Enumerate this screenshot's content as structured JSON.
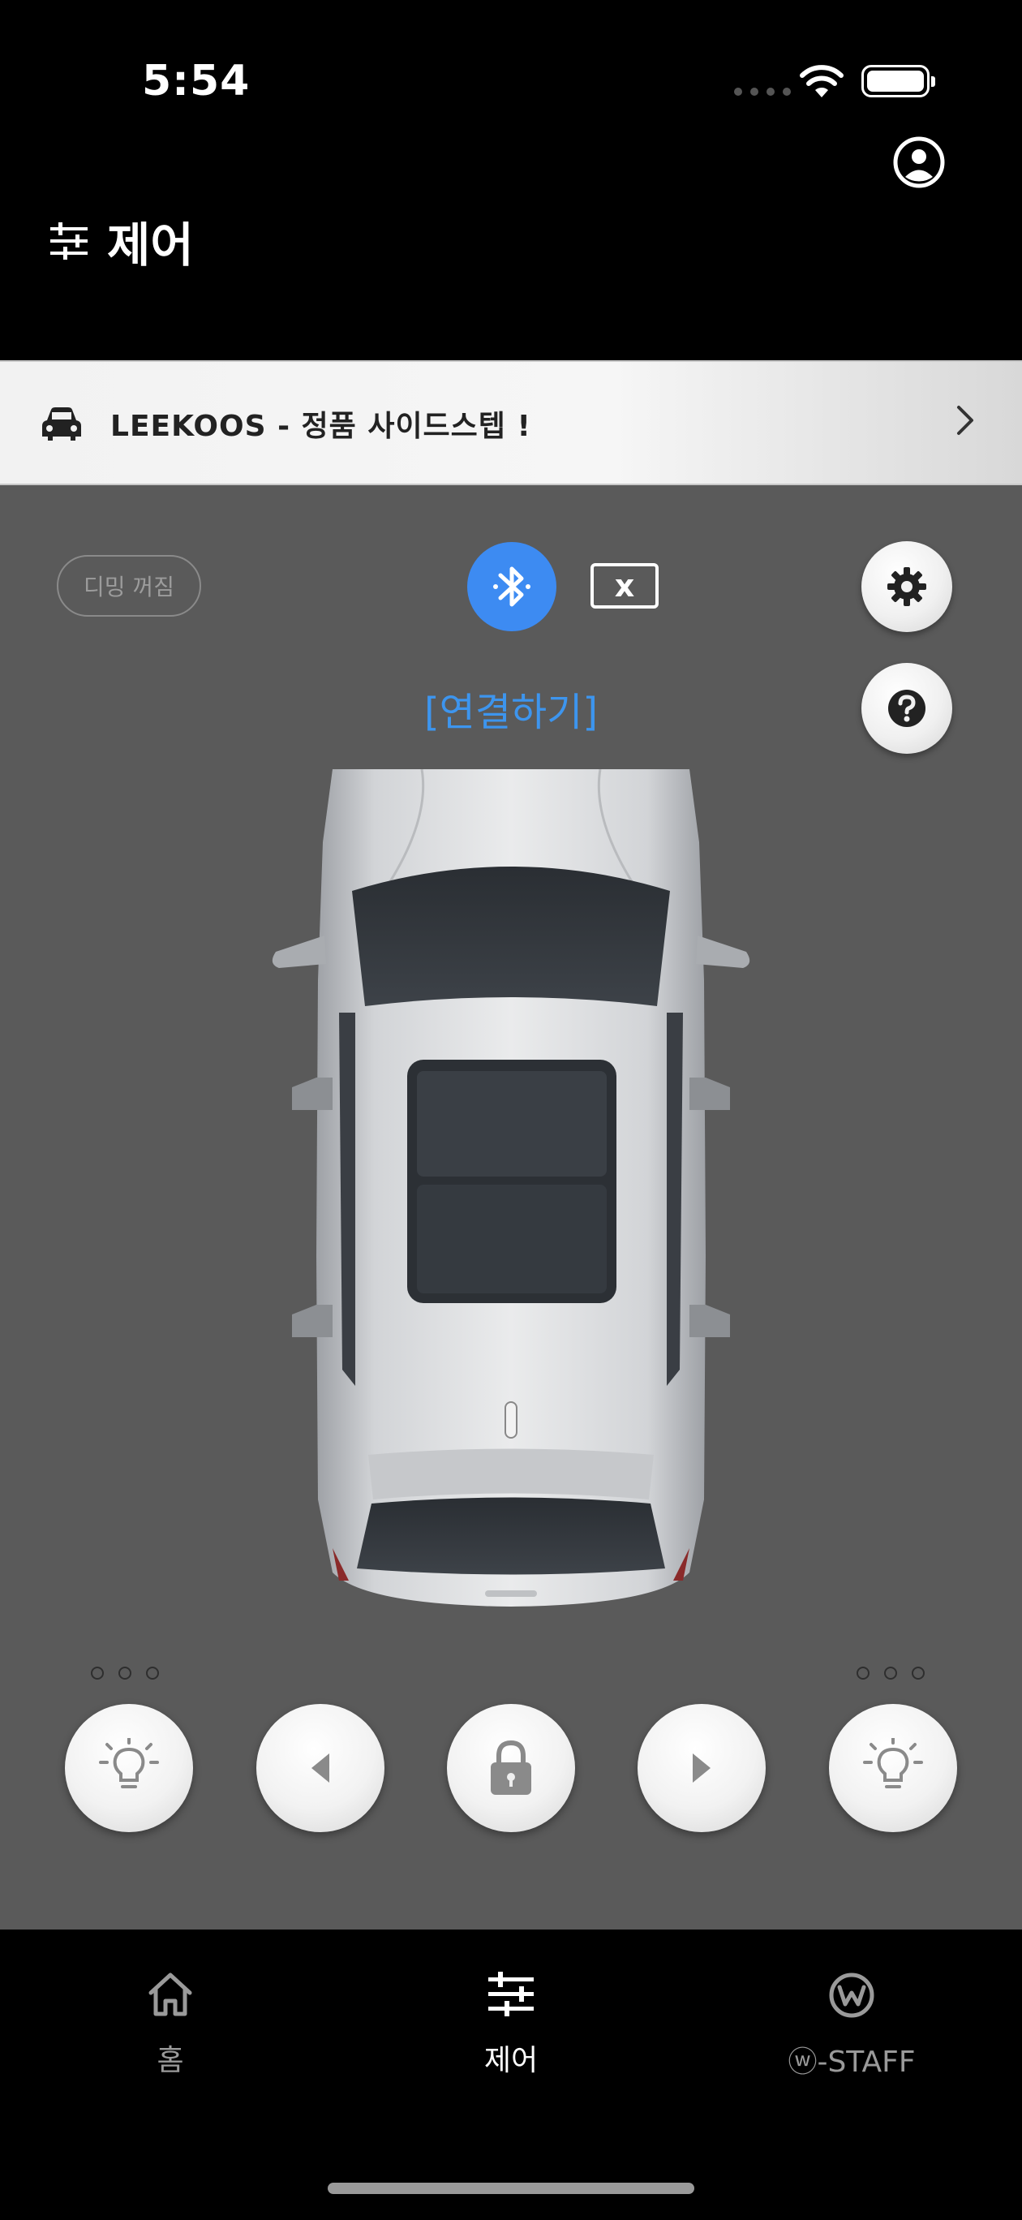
{
  "status_bar": {
    "time": "5:54"
  },
  "header": {
    "title": "제어",
    "icon": "sliders-icon",
    "profile_icon": "user-circle-icon"
  },
  "banner": {
    "text": "LEEKOOS - 정품 사이드스텝 !",
    "icon": "car-icon",
    "chevron": "chevron-right-icon"
  },
  "control": {
    "dimming_label": "디밍 꺼짐",
    "bluetooth_icon": "bluetooth-icon",
    "disconnected_badge": "x",
    "connect_label": "[연결하기]",
    "settings_icon": "gear-icon",
    "help_icon": "question-icon"
  },
  "buttons": [
    {
      "name": "left-light-button",
      "icon": "lightbulb-icon"
    },
    {
      "name": "left-arrow-button",
      "icon": "triangle-left-icon"
    },
    {
      "name": "lock-button",
      "icon": "lock-icon"
    },
    {
      "name": "right-arrow-button",
      "icon": "triangle-right-icon"
    },
    {
      "name": "right-light-button",
      "icon": "lightbulb-icon"
    }
  ],
  "tabs": [
    {
      "label": "홈",
      "icon": "home-icon",
      "active": false
    },
    {
      "label": "제어",
      "icon": "sliders-icon",
      "active": true
    },
    {
      "label": "ⓦ-STAFF",
      "icon": "w-logo-icon",
      "active": false
    }
  ],
  "colors": {
    "accent_blue": "#3d8bf2",
    "connect_text": "#3d95ee",
    "control_bg": "#5a5a5a",
    "inactive_tab": "#9a9a9a",
    "active_tab": "#ffffff"
  }
}
